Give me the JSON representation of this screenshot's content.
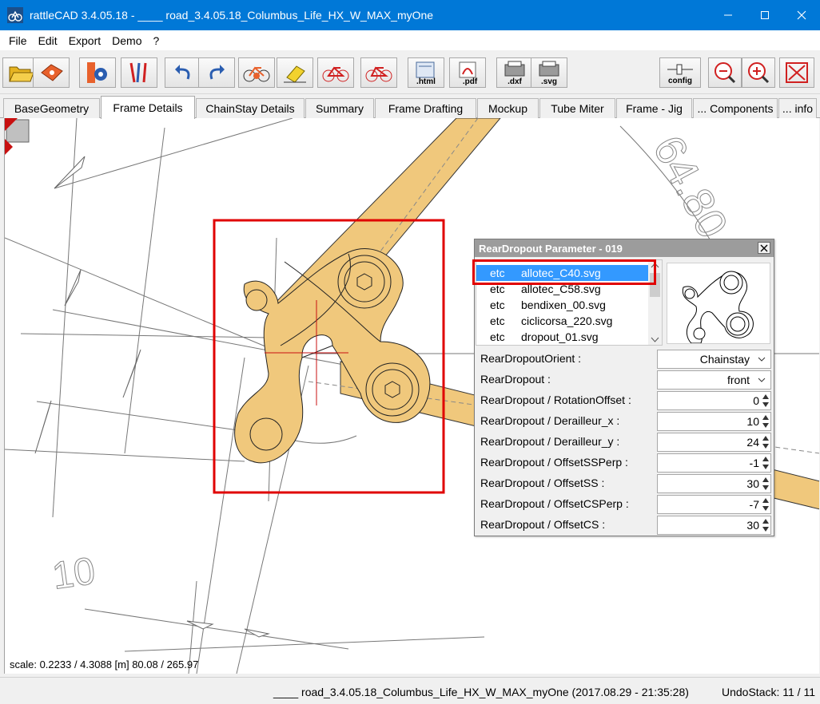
{
  "window": {
    "title": "rattleCAD  3.4.05.18 - ____ road_3.4.05.18_Columbus_Life_HX_W_MAX_myOne",
    "accent": "#0078d7"
  },
  "menu": [
    {
      "label": "File"
    },
    {
      "label": "Edit"
    },
    {
      "label": "Export"
    },
    {
      "label": "Demo"
    },
    {
      "label": "?"
    }
  ],
  "toolbar": {
    "html_label": ".html",
    "pdf_label": ".pdf",
    "dxf_label": ".dxf",
    "svg_label": ".svg",
    "config_label": "config"
  },
  "tabs": [
    {
      "label": "BaseGeometry"
    },
    {
      "label": "Frame Details",
      "active": true
    },
    {
      "label": "ChainStay Details"
    },
    {
      "label": "Summary"
    },
    {
      "label": "Frame Drafting"
    },
    {
      "label": "Mockup"
    },
    {
      "label": "Tube Miter"
    },
    {
      "label": "Frame - Jig"
    },
    {
      "label": "... Components"
    },
    {
      "label": "... info"
    }
  ],
  "canvas": {
    "scale_text": "scale: 0.2233 / 4.3088  [m]  80.08 / 265.97",
    "dim_label_left": "10",
    "dim_label_top": "64.80"
  },
  "dialog": {
    "title": "RearDropout Parameter - 019",
    "files": [
      {
        "folder": "etc",
        "name": "allotec_C40.svg",
        "selected": true
      },
      {
        "folder": "etc",
        "name": "allotec_C58.svg"
      },
      {
        "folder": "etc",
        "name": "bendixen_00.svg"
      },
      {
        "folder": "etc",
        "name": "ciclicorsa_220.svg"
      },
      {
        "folder": "etc",
        "name": "dropout_01.svg"
      }
    ],
    "params": [
      {
        "label": "RearDropoutOrient  :",
        "type": "select",
        "value": "Chainstay"
      },
      {
        "label": "RearDropout  :",
        "type": "select",
        "value": "front"
      },
      {
        "label": "RearDropout / RotationOffset  :",
        "type": "spin",
        "value": "0"
      },
      {
        "label": "RearDropout / Derailleur_x  :",
        "type": "spin",
        "value": "10"
      },
      {
        "label": "RearDropout / Derailleur_y  :",
        "type": "spin",
        "value": "24"
      },
      {
        "label": "RearDropout / OffsetSSPerp  :",
        "type": "spin",
        "value": "-1"
      },
      {
        "label": "RearDropout / OffsetSS  :",
        "type": "spin",
        "value": "30"
      },
      {
        "label": "RearDropout / OffsetCSPerp  :",
        "type": "spin",
        "value": "-7"
      },
      {
        "label": "RearDropout / OffsetCS  :",
        "type": "spin",
        "value": "30"
      }
    ]
  },
  "status": {
    "file": "____ road_3.4.05.18_Columbus_Life_HX_W_MAX_myOne (2017.08.29 - 21:35:28)",
    "undo": "UndoStack: 11 / 11"
  },
  "colors": {
    "tube_fill": "#f0c87c",
    "highlight": "#e00000",
    "selection": "#3399ff"
  }
}
